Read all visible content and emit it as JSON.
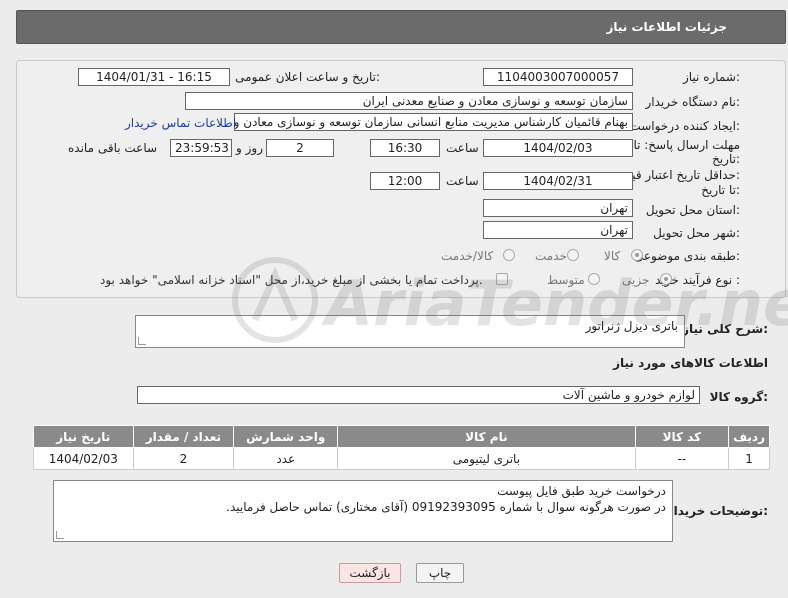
{
  "header": {
    "title": "جزئیات اطلاعات نیاز"
  },
  "form": {
    "need_number_label": "شماره نیاز:",
    "need_number": "1104003007000057",
    "announce_label": "تاریخ و ساعت اعلان عمومی:",
    "announce_value": "1404/01/31 - 16:15",
    "buyer_org_label": "نام دستگاه خریدار:",
    "buyer_org": "سازمان توسعه و نوسازی معادن و صنایع معدنی ایران",
    "creator_label": "ایجاد کننده درخواست:",
    "creator": "بهنام قائمیان کارشناس مدیریت منابع انسانی سازمان توسعه و نوسازی معادن و",
    "contact_link": "اطلاعات تماس خریدار",
    "deadline_label_1": "مهلت ارسال پاسخ: تا",
    "deadline_label_2": "تاریخ:",
    "deadline_date": "1404/02/03",
    "time_label": "ساعت",
    "deadline_time": "16:30",
    "days_value": "2",
    "days_label": "روز و",
    "remaining_time": "23:59:53",
    "remaining_label": "ساعت باقی مانده",
    "price_label_1": "حداقل تاریخ اعتبار قیمت:",
    "price_label_2": "تا تاریخ:",
    "price_date": "1404/02/31",
    "price_time": "12:00",
    "province_label": "استان محل تحویل:",
    "province": "تهران",
    "city_label": "شهر محل تحویل:",
    "city": "تهران",
    "category_label": "طبقه بندی موضوعی:",
    "category_options": [
      "کالا",
      "خدمت",
      "کالا/خدمت"
    ],
    "process_label": "نوع فرآیند خرید :",
    "process_options": [
      "جزیی",
      "متوسط"
    ],
    "payment_note": "پرداخت تمام یا بخشی از مبلغ خرید،از محل \"اسناد خزانه اسلامی\" خواهد بود."
  },
  "description": {
    "label": "شرح کلی نیاز:",
    "value": "باتری دیزل ژنراتور"
  },
  "goods": {
    "section_title": "اطلاعات کالاهای مورد نیاز",
    "group_label": "گروه کالا:",
    "group_value": "لوازم خودرو و ماشین آلات",
    "columns": [
      "ردیف",
      "کد کالا",
      "نام کالا",
      "واحد شمارش",
      "تعداد / مقدار",
      "تاریخ نیاز"
    ],
    "rows": [
      [
        "1",
        "--",
        "باتری لیتیومی",
        "عدد",
        "2",
        "1404/02/03"
      ]
    ]
  },
  "buyer_notes": {
    "label": "توضیحات خریدار:",
    "line1": "درخواست خرید طبق فایل پیوست",
    "line2": "در صورت هرگونه سوال با شماره 09192393095 (آقای مختاری) تماس حاصل فرمایید."
  },
  "buttons": {
    "print": "چاپ",
    "back": "بازگشت"
  },
  "watermark": {
    "text": "AriaTender.neT"
  }
}
